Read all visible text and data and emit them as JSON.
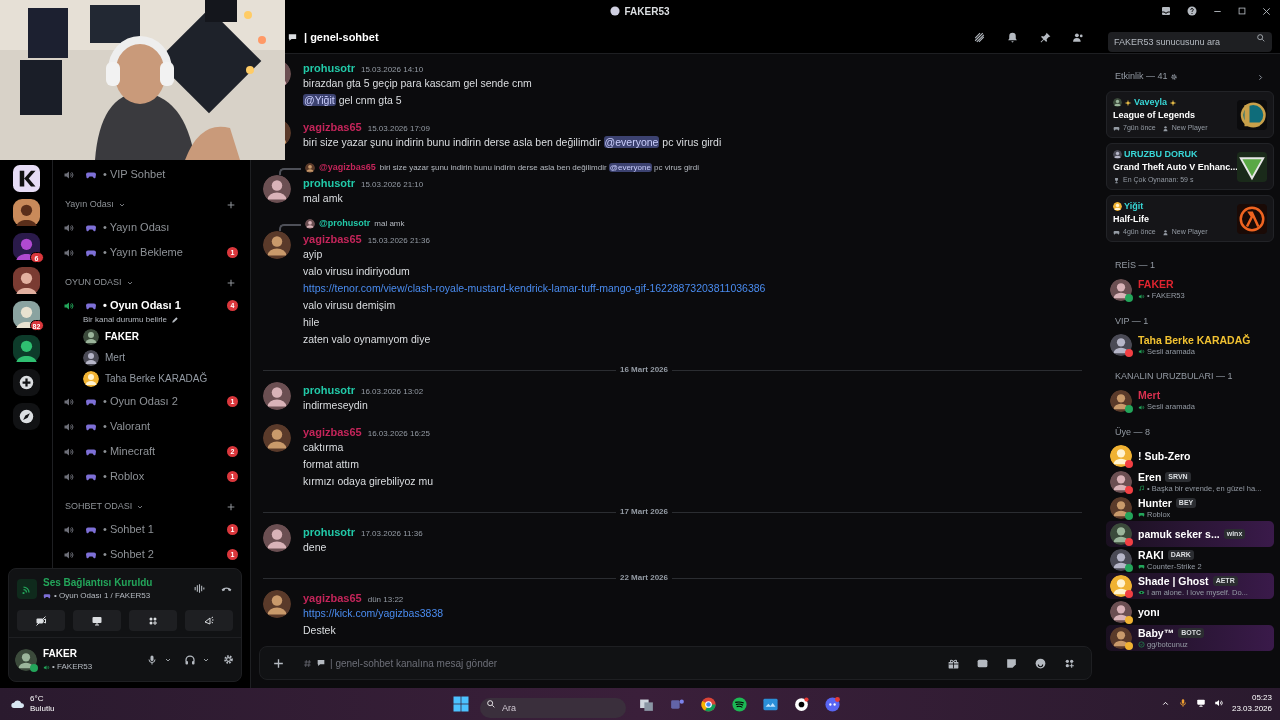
{
  "window": {
    "title": "FAKER53"
  },
  "servers": [
    {
      "kind": "logo"
    },
    {
      "kind": "server"
    },
    {
      "kind": "server",
      "badge": "6"
    },
    {
      "kind": "server"
    },
    {
      "kind": "server",
      "badge": "82"
    },
    {
      "kind": "server"
    },
    {
      "kind": "add"
    },
    {
      "kind": "discover"
    }
  ],
  "channel_list": [
    {
      "kind": "channel",
      "name": "• VIP Sohbet",
      "selected": false
    },
    {
      "kind": "category",
      "label": "Yayın Odası"
    },
    {
      "kind": "channel",
      "name": "• Yayın Odası",
      "selected": false
    },
    {
      "kind": "channel",
      "name": "• Yayın Bekleme",
      "selected": false,
      "badge": "1"
    },
    {
      "kind": "category",
      "label": "OYUN ODASI"
    },
    {
      "kind": "channel",
      "name": "• Oyun Odası 1",
      "selected": true,
      "badge": "4"
    },
    {
      "kind": "hint",
      "text": "Bir kanal durumu belirle"
    },
    {
      "kind": "member",
      "name": "FAKER",
      "selected": true
    },
    {
      "kind": "member",
      "name": "Mert",
      "selected": false
    },
    {
      "kind": "member",
      "name": "Taha Berke KARADAĞ",
      "selected": false
    },
    {
      "kind": "channel",
      "name": "• Oyun Odası 2",
      "selected": false,
      "badge": "1"
    },
    {
      "kind": "channel",
      "name": "• Valorant",
      "selected": false
    },
    {
      "kind": "channel",
      "name": "• Minecraft",
      "selected": false,
      "badge": "2"
    },
    {
      "kind": "channel",
      "name": "• Roblox",
      "selected": false,
      "badge": "1"
    },
    {
      "kind": "category",
      "label": "SOHBET ODASI"
    },
    {
      "kind": "channel",
      "name": "• Sohbet 1",
      "selected": false,
      "badge": "1"
    },
    {
      "kind": "channel",
      "name": "• Sohbet 2",
      "selected": false,
      "badge": "1"
    }
  ],
  "voice_panel": {
    "status": "Ses Bağlantısı Kuruldu",
    "location": "• Oyun Odası 1 / FAKER53"
  },
  "user_panel": {
    "name": "FAKER",
    "status": "• FAKER53",
    "presence": {
      "color": "#23a55a"
    }
  },
  "channel_header": {
    "name": "| genel-sohbet"
  },
  "search": {
    "placeholder": "FAKER53 sunucusunu ara"
  },
  "messages": [
    {
      "kind": "message",
      "author": "prohusotr",
      "color": "#22c9a8",
      "time": "15.03.2026 14:10",
      "lines": [
        [
          {
            "kind": "text",
            "text": "birazdan gta 5 geçip para kascam gel sende cnm"
          }
        ],
        [
          {
            "kind": "mention",
            "text": "@Yiğit"
          },
          {
            "kind": "text",
            "text": "gel cnm gta 5"
          }
        ]
      ]
    },
    {
      "kind": "message",
      "author": "yagizbas65",
      "color": "#c4255a",
      "time": "15.03.2026 17:09",
      "lines": [
        [
          {
            "kind": "text",
            "text": "biri size yazar şunu indirin bunu indirin derse asla ben değilimdir"
          },
          {
            "kind": "mention",
            "text": "@everyone"
          },
          {
            "kind": "text",
            "text": "pc virus girdi"
          }
        ]
      ]
    },
    {
      "kind": "message",
      "author": "prohusotr",
      "color": "#22c9a8",
      "time": "15.03.2026 21:10",
      "reply": {
        "author": "@yagizbas65",
        "color": "#c4255a",
        "parts": [
          {
            "kind": "text",
            "text": "biri size yazar şunu indirin bunu indirin derse asla ben değilimdir"
          },
          {
            "kind": "mention",
            "text": "@everyone"
          },
          {
            "kind": "text",
            "text": "pc virus girdi"
          }
        ]
      },
      "lines": [
        [
          {
            "kind": "text",
            "text": "mal amk"
          }
        ]
      ]
    },
    {
      "kind": "message",
      "author": "yagizbas65",
      "color": "#c4255a",
      "time": "15.03.2026 21:36",
      "reply": {
        "author": "@prohusotr",
        "color": "#22c9a8",
        "parts": [
          {
            "kind": "text",
            "text": "mal amk"
          }
        ]
      },
      "lines": [
        [
          {
            "kind": "text",
            "text": "ayip"
          }
        ],
        [
          {
            "kind": "text",
            "text": "valo virusu indiriyodum"
          }
        ],
        [
          {
            "kind": "link",
            "text": "https://tenor.com/view/clash-royale-mustard-kendrick-lamar-tuff-mango-gif-16228873203811036386"
          }
        ],
        [
          {
            "kind": "text",
            "text": "valo virusu demişim"
          }
        ],
        [
          {
            "kind": "text",
            "text": "hile"
          }
        ],
        [
          {
            "kind": "text",
            "text": "zaten valo oynamıyom diye"
          }
        ]
      ]
    },
    {
      "kind": "divider",
      "label": "16 Mart 2026"
    },
    {
      "kind": "message",
      "author": "prohusotr",
      "color": "#22c9a8",
      "time": "16.03.2026 13:02",
      "lines": [
        [
          {
            "kind": "text",
            "text": "indirmeseydin"
          }
        ]
      ]
    },
    {
      "kind": "message",
      "author": "yagizbas65",
      "color": "#c4255a",
      "time": "16.03.2026 16:25",
      "lines": [
        [
          {
            "kind": "text",
            "text": "caktırma"
          }
        ],
        [
          {
            "kind": "text",
            "text": "format attım"
          }
        ],
        [
          {
            "kind": "text",
            "text": "kırmızı odaya girebiliyoz mu"
          }
        ]
      ]
    },
    {
      "kind": "divider",
      "label": "17 Mart 2026"
    },
    {
      "kind": "message",
      "author": "prohusotr",
      "color": "#22c9a8",
      "time": "17.03.2026 11:36",
      "lines": [
        [
          {
            "kind": "text",
            "text": "dene"
          }
        ]
      ]
    },
    {
      "kind": "divider",
      "label": "22 Mart 2026"
    },
    {
      "kind": "message",
      "author": "yagizbas65",
      "color": "#c4255a",
      "time": "dün 13:22",
      "lines": [
        [
          {
            "kind": "link",
            "text": "https://kick.com/yagizbas3838"
          }
        ],
        [
          {
            "kind": "text",
            "text": "Destek"
          }
        ]
      ]
    }
  ],
  "composer": {
    "placeholder": "| genel-sohbet kanalına mesaj gönder"
  },
  "activity": {
    "title": "Etkinlik — 41",
    "cards": [
      {
        "kind": "ring",
        "user": "Vaveyla",
        "game": "League of Legends",
        "meta": [
          {
            "kind": "game",
            "text": "7gün önce"
          },
          {
            "kind": "player",
            "text": "New Player"
          }
        ]
      },
      {
        "kind": "triangle",
        "user": "URUZBU DORUK",
        "game": "Grand Theft Auto V Enhanc...",
        "meta": [
          {
            "kind": "trophy",
            "text": "En Çok Oynanan: 59 s"
          }
        ]
      },
      {
        "kind": "lambda",
        "user": "Yiğit",
        "game": "Half-Life",
        "meta": [
          {
            "kind": "game",
            "text": "4gün önce"
          },
          {
            "kind": "player",
            "text": "New Player"
          }
        ]
      }
    ]
  },
  "member_groups": [
    {
      "title": "REİS — 1",
      "members": [
        {
          "name": "FAKER",
          "color": "#e0242f",
          "presence": {
            "color": "#23a55a"
          },
          "status": {
            "kind": "voice",
            "text": "• FAKER53"
          }
        }
      ]
    },
    {
      "title": "VIP — 1",
      "members": [
        {
          "name": "Taha Berke KARADAĞ",
          "color": "#f1c232",
          "presence": {
            "color": "#f23f43"
          },
          "status": {
            "kind": "voice",
            "text": "Sesli aramada"
          }
        }
      ]
    },
    {
      "title": "KANALIN URUZBULARI — 1",
      "members": [
        {
          "name": "Mert",
          "color": "#d9304f",
          "presence": {
            "color": "#23a55a"
          },
          "status": {
            "kind": "voice",
            "text": "Sesli aramada"
          }
        }
      ]
    },
    {
      "title": "Üye — 8",
      "members": [
        {
          "name": "! Sub-Zero",
          "color": "#ffffff",
          "presence": {
            "color": "#f23f43"
          }
        },
        {
          "name": "Eren",
          "color": "#ffffff",
          "presence": {
            "color": "#f23f43"
          },
          "tag": "SRVN",
          "status": {
            "kind": "music",
            "text": "• Başka bir evrende, en güzel ha..."
          }
        },
        {
          "name": "Hunter",
          "color": "#ffffff",
          "presence": {
            "color": "#23a55a"
          },
          "tag": "BEY",
          "status": {
            "kind": "game",
            "text": "Roblox"
          }
        },
        {
          "name": "pamuk seker s...",
          "color": "#ffffff",
          "presence": {
            "color": "#f23f43"
          },
          "tag": "winx",
          "nameplate": true
        },
        {
          "name": "RAKI",
          "color": "#ffffff",
          "presence": {
            "color": "#23a55a"
          },
          "tag": "DARK",
          "status": {
            "kind": "game",
            "text": "Counter-Strike 2"
          }
        },
        {
          "name": "Shade | Ghost",
          "color": "#ffffff",
          "presence": {
            "color": "#f23f43"
          },
          "tag": "AETR",
          "status": {
            "kind": "eye",
            "text": "I am alone. I love myself. Do..."
          },
          "nameplate": true
        },
        {
          "name": "yonı",
          "color": "#ffffff",
          "presence": {
            "color": "#f0b232"
          }
        },
        {
          "name": "Baby™",
          "color": "#ffffff",
          "presence": {
            "color": "#f0b232"
          },
          "tag": "BOTC",
          "status": {
            "kind": "check",
            "text": "gg/botcunuz"
          },
          "nameplate": true
        }
      ]
    }
  ],
  "taskbar": {
    "temperature": "6°C",
    "condition": "Bulutlu",
    "search_placeholder": "Ara",
    "time": "05:23",
    "date": "23.03.2026"
  }
}
